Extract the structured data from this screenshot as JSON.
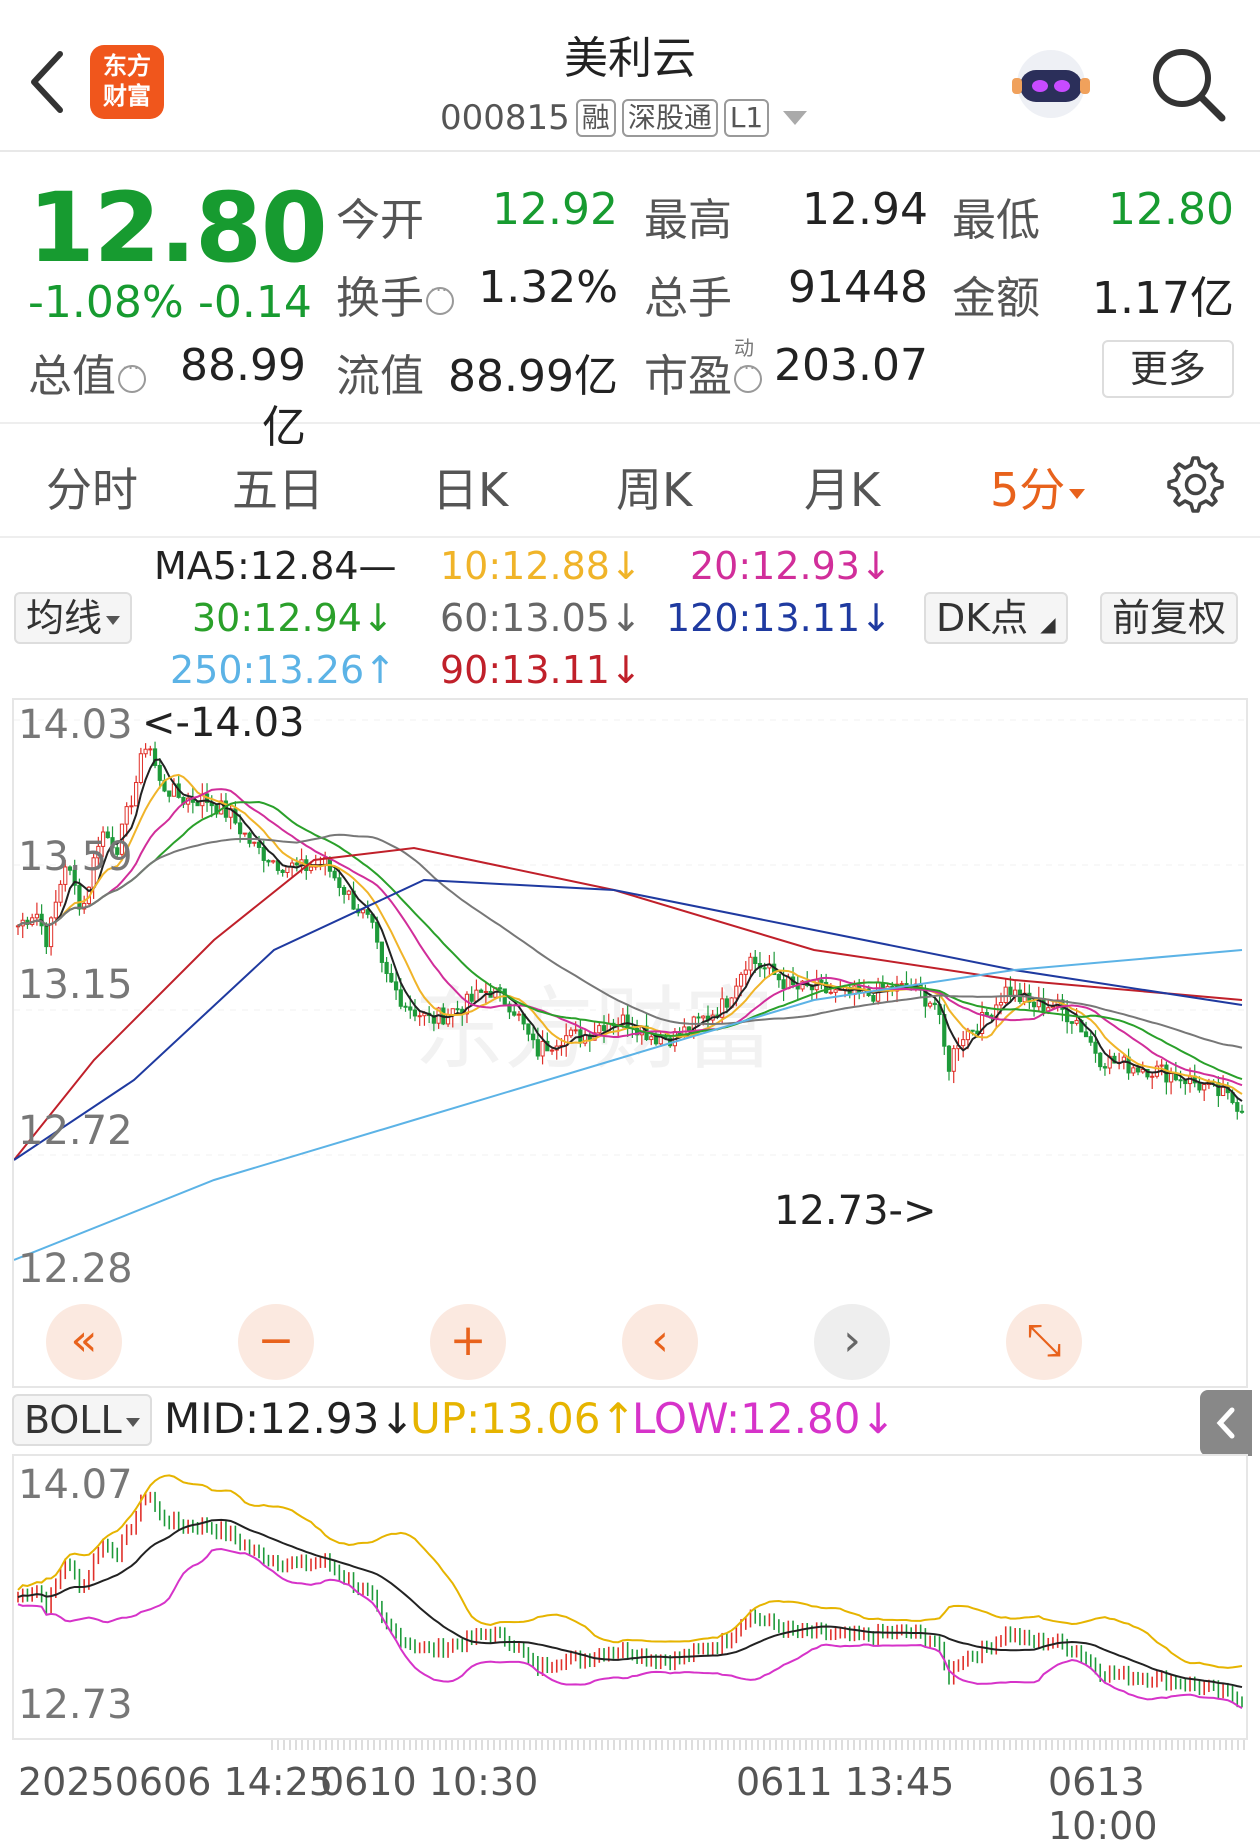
{
  "header": {
    "title": "美利云",
    "code": "000815",
    "tags": [
      "融",
      "深股通",
      "L1"
    ],
    "logo_text": [
      "东方",
      "财富"
    ]
  },
  "quote": {
    "price": "12.80",
    "pct": "-1.08%",
    "change": "-0.14",
    "rows": [
      [
        {
          "label": "今开",
          "value": "12.92",
          "green": true
        },
        {
          "label": "最高",
          "value": "12.94"
        },
        {
          "label": "最低",
          "value": "12.80",
          "green": true
        }
      ],
      [
        {
          "label": "换手",
          "value": "1.32%"
        },
        {
          "label": "总手",
          "value": "91448"
        },
        {
          "label": "金额",
          "value": "1.17亿"
        }
      ],
      [
        {
          "label": "总值",
          "value": "88.99亿"
        },
        {
          "label": "流值",
          "value": "88.99亿"
        },
        {
          "label": "市盈",
          "value": "203.07"
        }
      ]
    ],
    "pe_sup": "动",
    "more_label": "更多"
  },
  "tabs": [
    {
      "label": "分时"
    },
    {
      "label": "五日"
    },
    {
      "label": "日K"
    },
    {
      "label": "周K"
    },
    {
      "label": "月K"
    },
    {
      "label": "5分",
      "active": true
    }
  ],
  "ma_legend": {
    "selector": "均线",
    "ma5": "MA5:12.84—",
    "ma10": "10:12.88↓",
    "ma20": "20:12.93↓",
    "ma30": "30:12.94↓",
    "ma60": "60:13.05↓",
    "ma120": "120:13.11↓",
    "ma250": "250:13.26↑",
    "ma90": "90:13.11↓",
    "dk": "DK点",
    "adjust": "前复权",
    "colors": {
      "ma5": "#222222",
      "ma10": "#f0b429",
      "ma20": "#d12e9a",
      "ma30": "#2aa02a",
      "ma60": "#777777",
      "ma120": "#1f3aa0",
      "ma250": "#5cb3e6",
      "ma90": "#c0202a"
    }
  },
  "main_chart": {
    "y_labels": [
      "14.03",
      "13.59",
      "13.15",
      "12.72",
      "12.28"
    ],
    "high_annot": "<-14.03",
    "low_annot": "12.73->",
    "controls": [
      "«",
      "−",
      "+",
      "‹",
      "›",
      "⤡"
    ]
  },
  "boll": {
    "selector": "BOLL",
    "mid": "MID:12.93↓",
    "up": "UP:13.06↑",
    "low": "LOW:12.80↓",
    "y_labels": [
      "14.07",
      "12.73"
    ],
    "colors": {
      "mid": "#222222",
      "up": "#e6b400",
      "low": "#d633c9"
    }
  },
  "x_axis": [
    "20250606 14:25",
    "0610 10:30",
    "0611 13:45",
    "0613 10:00"
  ]
}
